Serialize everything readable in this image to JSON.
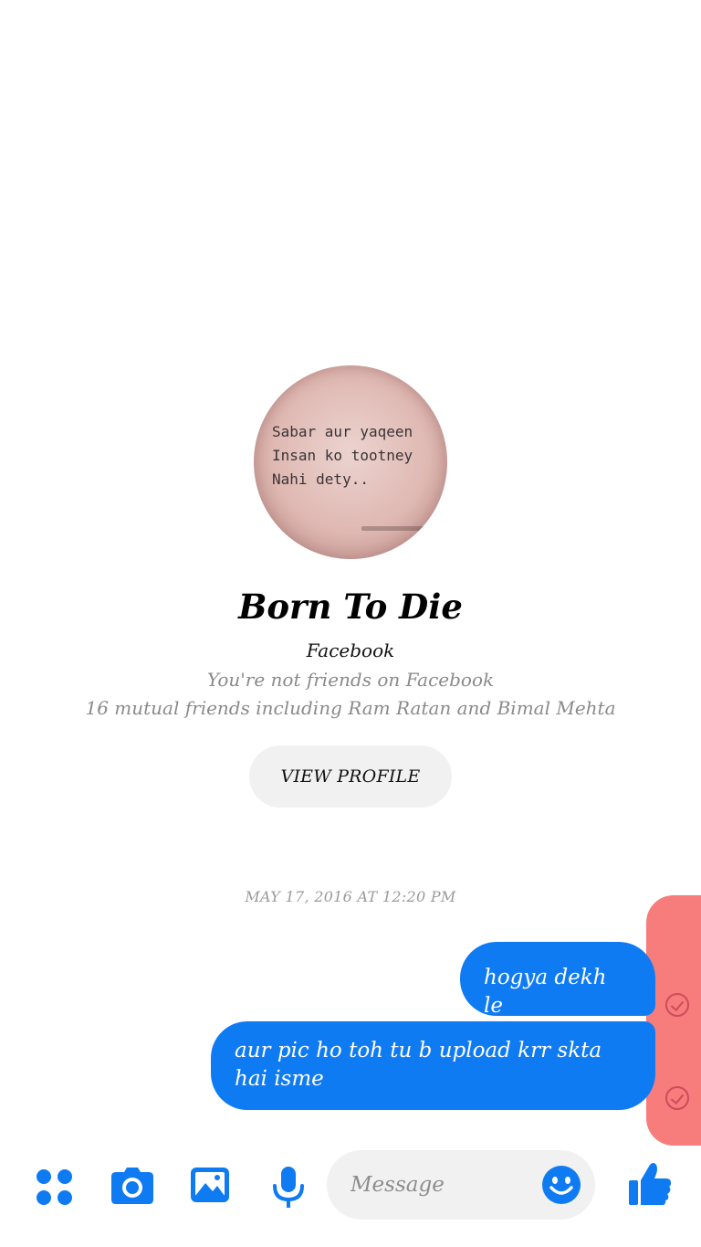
{
  "profile": {
    "avatar_caption": "Sabar aur yaqeen\nInsan ko tootney\nNahi dety..",
    "name": "Born To Die",
    "source": "Facebook",
    "friend_status": "You're not friends on Facebook",
    "mutual_friends": "16 mutual friends including Ram Ratan and Bimal Mehta",
    "view_profile_label": "VIEW PROFILE"
  },
  "conversation": {
    "timestamp": "MAY 17, 2016 AT 12:20 PM",
    "messages": [
      {
        "text": "hogya dekh le",
        "direction": "outgoing",
        "status": "sent"
      },
      {
        "text": "aur pic ho toh tu b upload krr skta hai isme",
        "direction": "outgoing",
        "status": "sent"
      }
    ]
  },
  "composer": {
    "placeholder": "Message",
    "icons": [
      "apps-icon",
      "camera-icon",
      "image-icon",
      "microphone-icon",
      "emoji-icon",
      "thumbs-up-icon"
    ]
  },
  "colors": {
    "accent": "#0f7bf3",
    "bubble_text": "#ffffff",
    "highlight": "#f77c7c",
    "read_check": "#d04a5c",
    "muted_text": "#8a8a8a",
    "pill_background": "#f1f1f1"
  }
}
